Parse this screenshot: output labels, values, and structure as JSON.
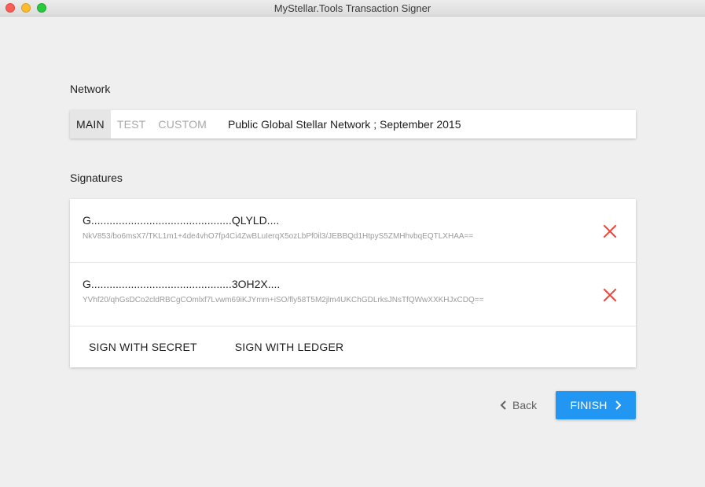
{
  "window": {
    "title": "MyStellar.Tools Transaction Signer"
  },
  "network": {
    "label": "Network",
    "tabs": [
      {
        "label": "MAIN",
        "active": true
      },
      {
        "label": "TEST",
        "active": false
      },
      {
        "label": "CUSTOM",
        "active": false
      }
    ],
    "passphrase": "Public Global Stellar Network ; September 2015"
  },
  "signatures": {
    "label": "Signatures",
    "items": [
      {
        "key": "G..............................................QLYLD....",
        "value": "NkV853/bo6msX7/TKL1m1+4de4vhO7fp4Ci4ZwBLuIerqX5ozLbPf0il3/JEBBQd1HtpyS5ZMHhvbqEQTLXHAA=="
      },
      {
        "key": "G..............................................3OH2X....",
        "value": "YVhf20/qhGsDCo2cldRBCgCOmlxf7Lvwm69iKJYmm+iSO/fly58T5M2jlm4UKChGDLrksJNsTfQWwXXKHJxCDQ=="
      }
    ],
    "actions": {
      "sign_secret": "SIGN WITH SECRET",
      "sign_ledger": "SIGN WITH LEDGER"
    }
  },
  "footer": {
    "back_label": "Back",
    "finish_label": "FINISH"
  },
  "colors": {
    "accent": "#2196f3",
    "remove": "#f44336",
    "background": "#efefef"
  },
  "icons": {
    "remove": "close-icon",
    "back": "chevron-left-icon",
    "finish": "chevron-right-icon"
  }
}
